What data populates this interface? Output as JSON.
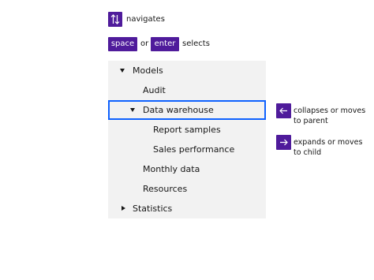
{
  "legend": {
    "nav_text": "navigates",
    "space_key": "space",
    "or_text": "or",
    "enter_key": "enter",
    "selects_text": "selects"
  },
  "tree": {
    "items": [
      {
        "label": "Models",
        "caret": "down",
        "level": 0
      },
      {
        "label": "Audit",
        "caret": "none",
        "level": 1
      },
      {
        "label": "Data warehouse",
        "caret": "down",
        "level": 1,
        "selected": true
      },
      {
        "label": "Report samples",
        "caret": "none",
        "level": 2
      },
      {
        "label": "Sales performance",
        "caret": "none",
        "level": 2
      },
      {
        "label": "Monthly data",
        "caret": "none",
        "level": 1
      },
      {
        "label": "Resources",
        "caret": "none",
        "level": 1
      },
      {
        "label": "Statistics",
        "caret": "right",
        "level": 0
      }
    ]
  },
  "hints": {
    "left": {
      "icon": "arrow-left-icon",
      "line1": "collapses or moves",
      "line2": "to parent"
    },
    "right": {
      "icon": "arrow-right-icon",
      "line1": "expands or moves",
      "line2": "to child"
    }
  },
  "colors": {
    "accent": "#4f1b9b",
    "focus": "#0f62fe",
    "tree_bg": "#f2f2f2"
  }
}
